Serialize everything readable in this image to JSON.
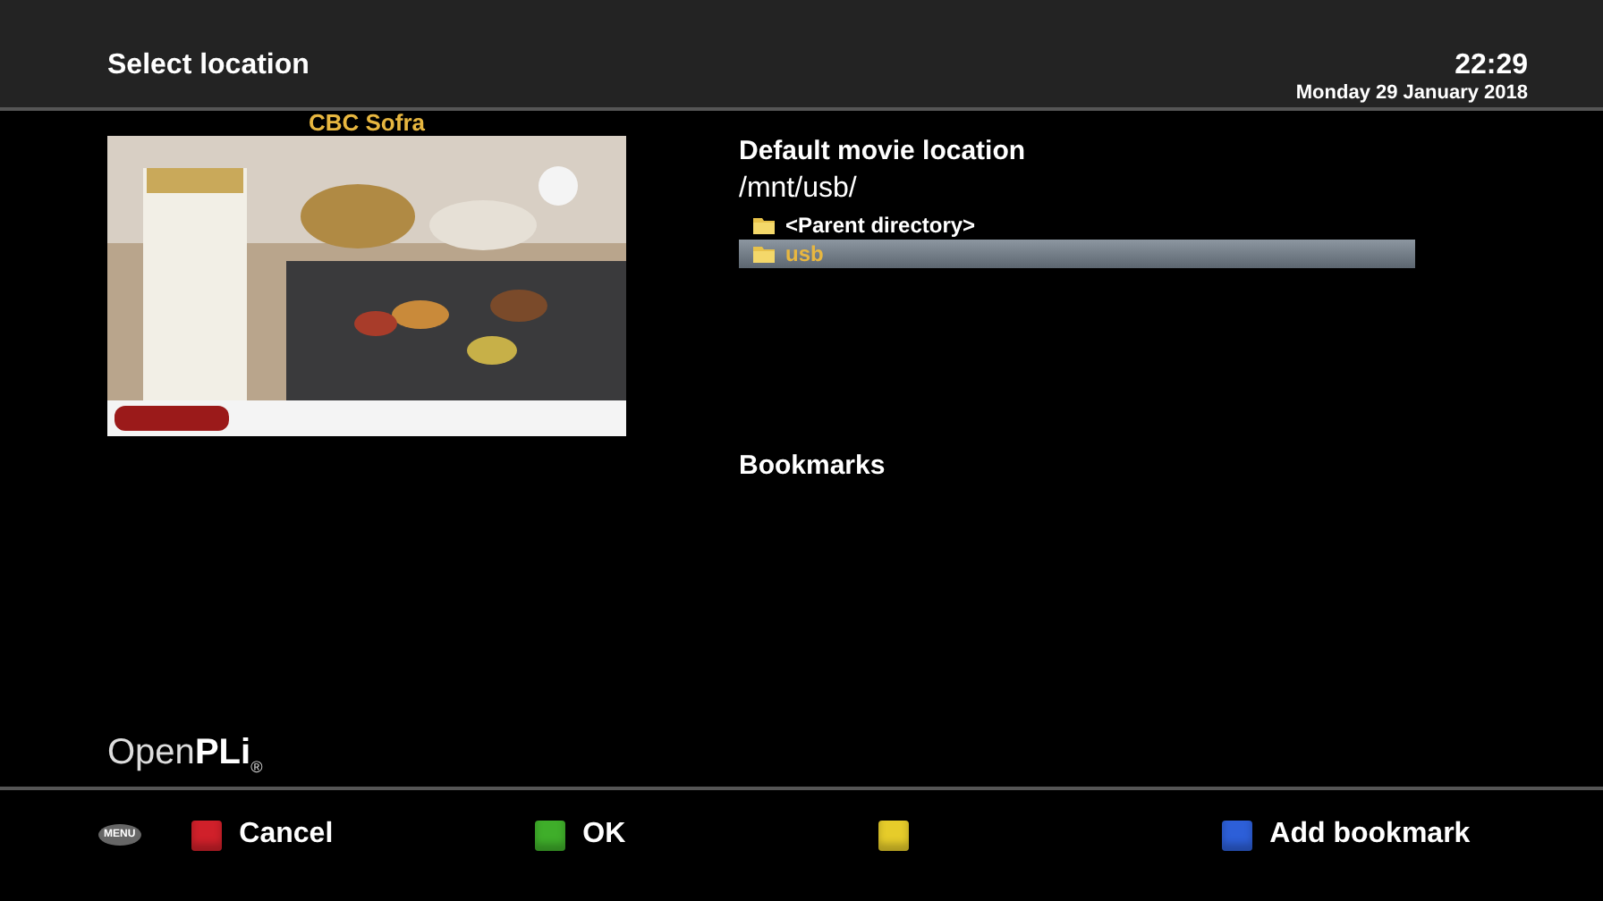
{
  "header": {
    "title": "Select location",
    "time": "22:29",
    "date": "Monday 29 January 2018"
  },
  "preview": {
    "channel": "CBC Sofra",
    "kind": "picture"
  },
  "location": {
    "heading": "Default movie location",
    "path": "/mnt/usb/",
    "items": [
      {
        "label": "<Parent directory>",
        "selected": false
      },
      {
        "label": "usb",
        "selected": true
      }
    ]
  },
  "bookmarks": {
    "heading": "Bookmarks"
  },
  "logo": "Open**PLi**$_{®}$",
  "footer": {
    "menu_key": "MENU",
    "buttons": [
      {
        "label": "Cancel",
        "color": "#d0202a"
      },
      {
        "label": "OK",
        "color": "#3fae2a"
      },
      {
        "color": "#e6cc2a"
      },
      {
        "label": "Add bookmark",
        "color": "#2d5fd8"
      }
    ]
  }
}
